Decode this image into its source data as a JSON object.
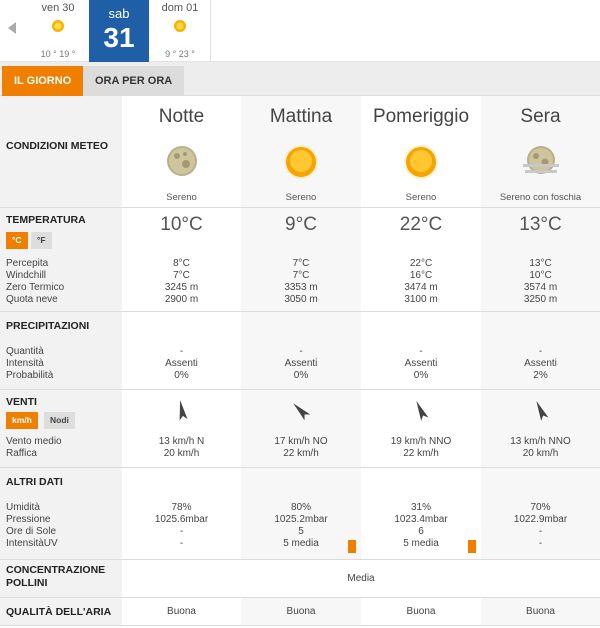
{
  "days": [
    {
      "name": "ven 30",
      "temps": "10 ° 19 °"
    },
    {
      "name": "sab",
      "num": "31"
    },
    {
      "name": "dom 01",
      "temps": "9 ° 23 °"
    }
  ],
  "tabs": {
    "day": "IL GIORNO",
    "hourly": "ORA PER ORA"
  },
  "labels": {
    "conditions": "CONDIZIONI METEO",
    "temperature": "TEMPERATURA",
    "unit_c": "°C",
    "unit_f": "°F",
    "perceived": "Percepita",
    "windchill": "Windchill",
    "freezing": "Zero Termico",
    "snow": "Quota neve",
    "precip": "PRECIPITAZIONI",
    "quantity": "Quantità",
    "intensity": "Intensità",
    "probability": "Probabilità",
    "winds": "VENTI",
    "unit_kmh": "km/h",
    "unit_knots": "Nodi",
    "avg_wind": "Vento medio",
    "gust": "Raffica",
    "other": "ALTRI DATI",
    "humidity": "Umidità",
    "pressure": "Pressione",
    "sun_hours": "Ore di Sole",
    "uv": "IntensitàUV",
    "pollen": "CONCENTRAZIONE POLLINI",
    "air": "QUALITÀ DELL'ARIA"
  },
  "periods": [
    {
      "name": "Notte",
      "icon": "moon-icon",
      "cond": "Sereno",
      "temp": "10°C",
      "perceived": "8°C",
      "windchill": "7°C",
      "freezing": "3245 m",
      "snow": "2900 m",
      "qty": "-",
      "intensity": "Assenti",
      "prob": "0%",
      "wind_dir_deg": 170,
      "avg_wind": "13 km/h  N",
      "gust": "20 km/h",
      "humidity": "78%",
      "pressure": "1025.6mbar",
      "sun": "-",
      "uv": "-",
      "uv_bar": false,
      "air": "Buona"
    },
    {
      "name": "Mattina",
      "icon": "sun-icon",
      "cond": "Sereno",
      "temp": "9°C",
      "perceived": "7°C",
      "windchill": "7°C",
      "freezing": "3353 m",
      "snow": "3050 m",
      "qty": "-",
      "intensity": "Assenti",
      "prob": "0%",
      "wind_dir_deg": 135,
      "avg_wind": "17 km/h NO",
      "gust": "22 km/h",
      "humidity": "80%",
      "pressure": "1025.2mbar",
      "sun": "5",
      "uv": "5 media",
      "uv_bar": true,
      "air": "Buona"
    },
    {
      "name": "Pomeriggio",
      "icon": "sun-icon",
      "cond": "Sereno",
      "temp": "22°C",
      "perceived": "22°C",
      "windchill": "16°C",
      "freezing": "3474 m",
      "snow": "3100 m",
      "qty": "-",
      "intensity": "Assenti",
      "prob": "0%",
      "wind_dir_deg": 155,
      "avg_wind": "19 km/h NNO",
      "gust": "22 km/h",
      "humidity": "31%",
      "pressure": "1023.4mbar",
      "sun": "6",
      "uv": "5 media",
      "uv_bar": true,
      "air": "Buona"
    },
    {
      "name": "Sera",
      "icon": "moon-fog-icon",
      "cond": "Sereno con foschia",
      "temp": "13°C",
      "perceived": "13°C",
      "windchill": "10°C",
      "freezing": "3574 m",
      "snow": "3250 m",
      "qty": "-",
      "intensity": "Assenti",
      "prob": "2%",
      "wind_dir_deg": 155,
      "avg_wind": "13 km/h NNO",
      "gust": "20 km/h",
      "humidity": "70%",
      "pressure": "1022.9mbar",
      "sun": "-",
      "uv": "-",
      "uv_bar": false,
      "air": "Buona"
    }
  ],
  "pollen_value": "Media",
  "colors": {
    "accent": "#f07f00",
    "active_day": "#1f5fa8"
  }
}
